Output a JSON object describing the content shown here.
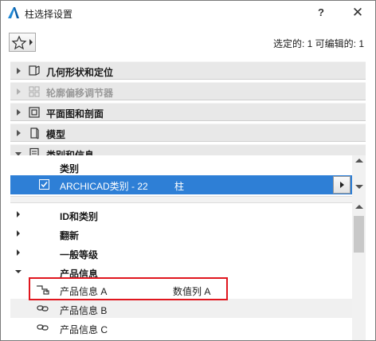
{
  "window": {
    "title": "柱选择设置",
    "help_label": "?",
    "close_label": "✕"
  },
  "toolbar": {
    "favorites_icon": "star-icon",
    "selection_info": "选定的: 1 可编辑的: 1"
  },
  "panels": [
    {
      "label": "几何形状和定位",
      "icon": "geometry-icon",
      "expanded": false,
      "enabled": true
    },
    {
      "label": "轮廓偏移调节器",
      "icon": "profile-offset-icon",
      "expanded": false,
      "enabled": false
    },
    {
      "label": "平面图和剖面",
      "icon": "floorplan-section-icon",
      "expanded": false,
      "enabled": true
    },
    {
      "label": "模型",
      "icon": "model-icon",
      "expanded": false,
      "enabled": true
    },
    {
      "label": "类别和信息",
      "icon": "classification-icon",
      "expanded": true,
      "enabled": true
    }
  ],
  "classification": {
    "header": "类别",
    "selected_row": {
      "label": "ARCHICAD类别 - 22",
      "value": "柱",
      "checked": true
    },
    "groups": [
      {
        "label": "ID和类别",
        "expanded": false
      },
      {
        "label": "翻新",
        "expanded": false
      },
      {
        "label": "一般等级",
        "expanded": false
      },
      {
        "label": "产品信息",
        "expanded": true
      }
    ],
    "properties": [
      {
        "label": "产品信息 A",
        "value": "数值列 A",
        "icon": "property-link-icon"
      },
      {
        "label": "产品信息 B",
        "value": "",
        "icon": "property-link-icon"
      },
      {
        "label": "产品信息 C",
        "value": "",
        "icon": "property-link-icon"
      }
    ]
  },
  "colors": {
    "selection": "#2e7fd6",
    "highlight_border": "#e0161e",
    "panel_bg": "#e8e8e8"
  }
}
